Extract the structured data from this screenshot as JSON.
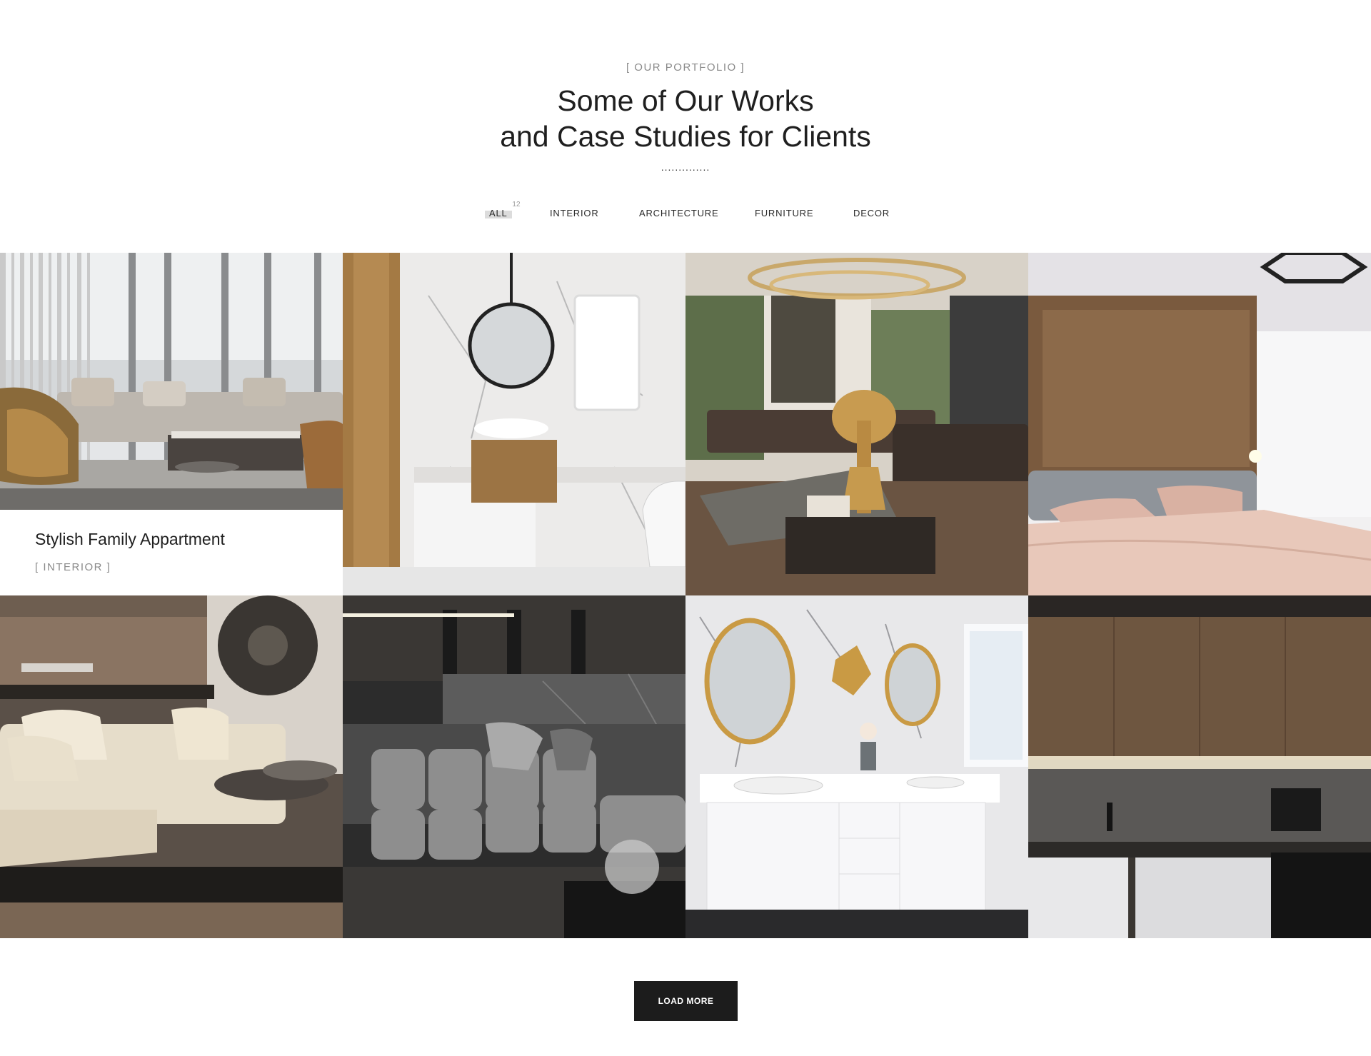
{
  "section": {
    "subtitle": "[ OUR PORTFOLIO ]",
    "title_line1": "Some of Our Works",
    "title_line2": "and Case Studies for Clients",
    "divider": ".............."
  },
  "filters": {
    "all": {
      "label": "ALL",
      "count": "12"
    },
    "interior": {
      "label": "INTERIOR"
    },
    "architecture": {
      "label": "ARCHITECTURE"
    },
    "furniture": {
      "label": "FURNITURE"
    },
    "decor": {
      "label": "DECOR"
    }
  },
  "portfolio": {
    "items": [
      {
        "image": "living-room-city-view-photo",
        "title": "Stylish Family Appartment",
        "category": "[ INTERIOR ]"
      },
      {
        "image": "marble-bathroom-photo"
      },
      {
        "image": "living-room-gold-chandelier-photo"
      },
      {
        "image": "wood-bedroom-photo"
      },
      {
        "image": "beige-sofa-living-room-photo"
      },
      {
        "image": "grey-sofa-living-room-photo"
      },
      {
        "image": "gold-mirror-bathroom-photo"
      },
      {
        "image": "dark-wood-kitchen-photo"
      }
    ]
  },
  "load_more": {
    "label": "LOAD MORE"
  },
  "colors": {
    "button_bg": "#1c1c1c",
    "accent_grey": "#8a8a8a"
  }
}
